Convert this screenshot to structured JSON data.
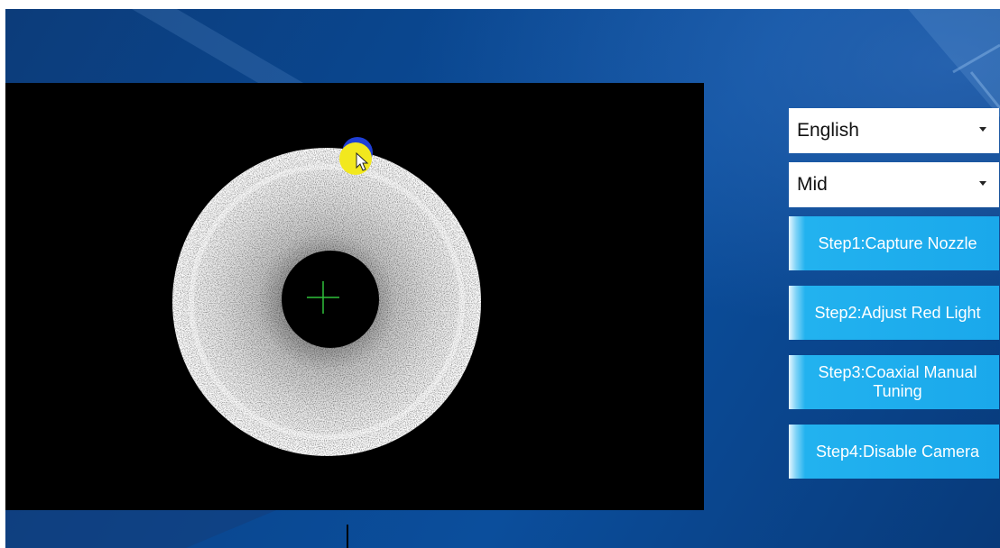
{
  "language_select": {
    "value": "English",
    "icon": "chevron-down-icon"
  },
  "mode_select": {
    "value": "Mid",
    "icon": "chevron-down-icon"
  },
  "steps": [
    {
      "label": "Step1:Capture Nozzle"
    },
    {
      "label": "Step2:Adjust Red Light"
    },
    {
      "label": "Step3:Coaxial Manual Tuning"
    },
    {
      "label": "Step4:Disable Camera"
    }
  ],
  "camera": {
    "crosshair_color": "#2fbf3a",
    "cursor_highlight_colors": [
      "#1f3fd6",
      "#f2e81e"
    ]
  },
  "colors": {
    "button_accent": "#1aa8eb",
    "background": "#0b4790"
  }
}
